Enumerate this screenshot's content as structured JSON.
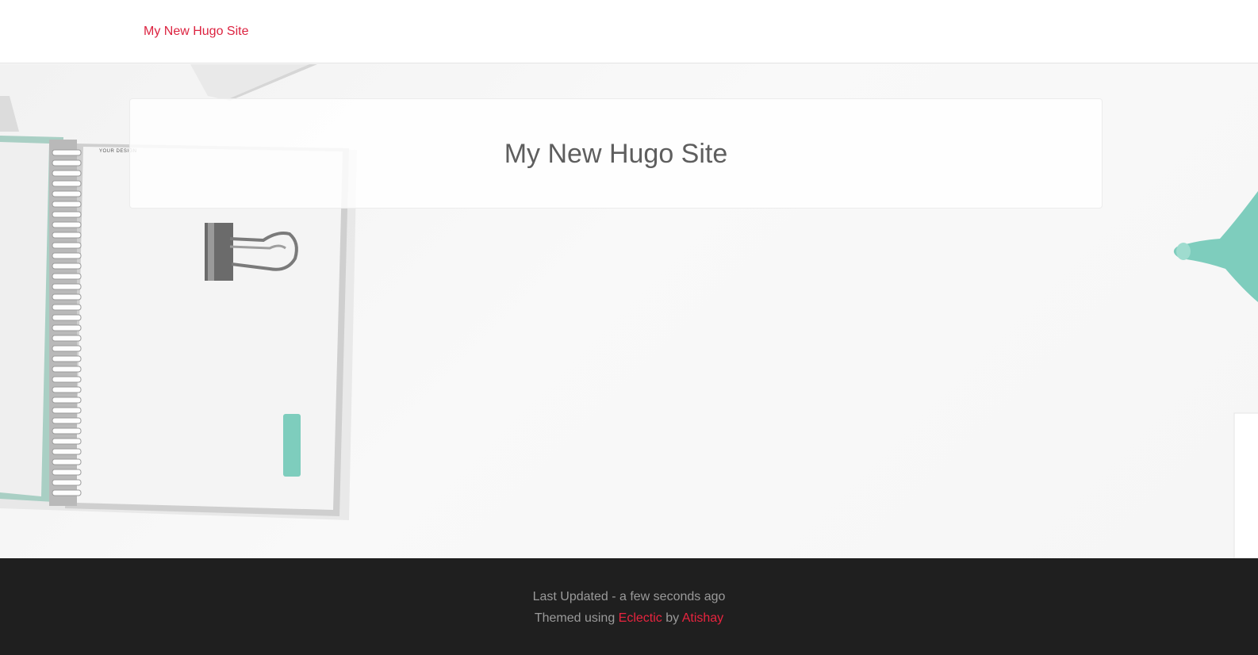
{
  "navbar": {
    "brand": "My New Hugo Site"
  },
  "hero": {
    "title": "My New Hugo Site",
    "notebook_cover_text": "YOUR DESIGN"
  },
  "footer": {
    "last_updated_prefix": "Last Updated - ",
    "last_updated_value": "a few seconds ago",
    "themed_prefix": "Themed using ",
    "theme_link": "Eclectic",
    "by_text": " by ",
    "author_link": "Atishay"
  },
  "colors": {
    "accent": "#dc2340",
    "footer_bg": "#1f1f1f",
    "footer_text": "#9a9a9a",
    "title_text": "#5e5e5e",
    "mint": "#7ecdbd"
  }
}
